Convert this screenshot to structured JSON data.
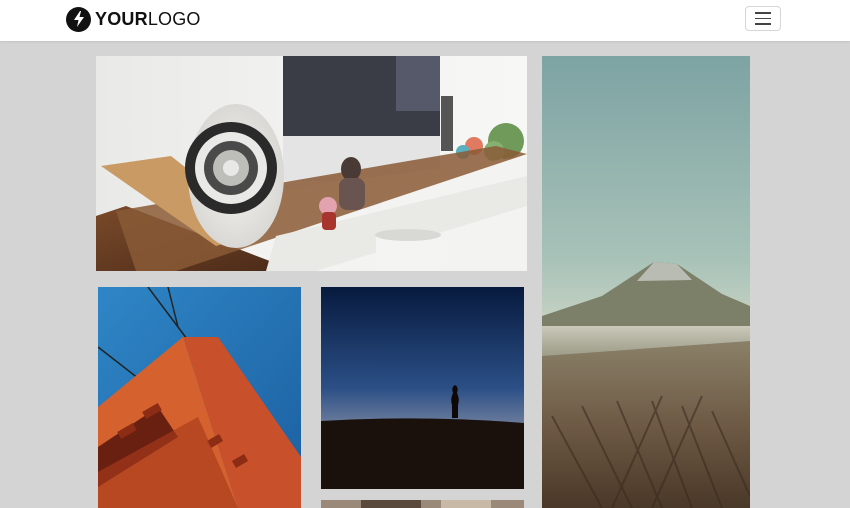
{
  "brand": {
    "bold": "YOUR",
    "light": "LOGO",
    "icon": "lightning-bolt-icon"
  },
  "nav": {
    "toggle_icon": "hamburger-menu-icon"
  },
  "gallery": {
    "tiles": [
      {
        "name": "photo-desk-speaker"
      },
      {
        "name": "photo-mountain-volcano"
      },
      {
        "name": "photo-red-bridge-tower"
      },
      {
        "name": "photo-sunset-silhouette"
      },
      {
        "name": "photo-partial-bottom"
      }
    ]
  },
  "colors": {
    "page_background": "#d4d4d4",
    "navbar_background": "#ffffff",
    "logo": "#111111"
  }
}
